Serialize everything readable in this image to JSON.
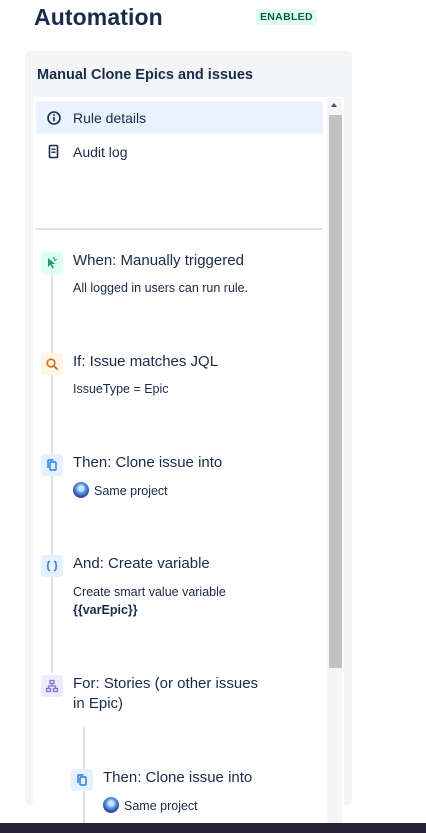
{
  "header": {
    "title": "Automation",
    "status": "ENABLED"
  },
  "panel": {
    "title": "Manual Clone Epics and issues",
    "nav": [
      {
        "label": "Rule details",
        "icon": "info-icon",
        "active": true
      },
      {
        "label": "Audit log",
        "icon": "document-icon",
        "active": false
      }
    ],
    "steps": [
      {
        "title": "When: Manually triggered",
        "subtitle": "All logged in users can run rule.",
        "icon": "cursor-click-icon",
        "kind": "trigger"
      },
      {
        "title": "If: Issue matches JQL",
        "subtitle": "IssueType = Epic",
        "icon": "magnifier-icon",
        "kind": "condition"
      },
      {
        "title": "Then: Clone issue into",
        "subtitle": "Same project",
        "icon": "copy-icon",
        "kind": "action"
      },
      {
        "title": "And: Create variable",
        "subtitle": "Create smart value variable",
        "subtitle_bold": "{{varEpic}}",
        "icon": "braces-icon",
        "kind": "action"
      },
      {
        "title_line1": "For: Stories (or other issues",
        "title_line2": "in Epic)",
        "icon": "hierarchy-icon",
        "kind": "branch"
      },
      {
        "title": "Then: Clone issue into",
        "subtitle": "Same project",
        "icon": "copy-icon",
        "kind": "action"
      }
    ]
  },
  "colors": {
    "trigger": "#22a06b",
    "condition": "#e56910",
    "action": "#1d7afc",
    "branch": "#8270db",
    "enabled_badge_bg": "#e3fcef",
    "enabled_badge_text": "#006644"
  }
}
